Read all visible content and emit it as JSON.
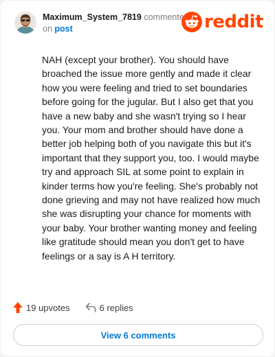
{
  "comment": {
    "username": "Maximum_System_7819",
    "action_text": "commented",
    "on_text": "on",
    "post_link": "post",
    "body": "NAH (except your brother). You should have broached the issue more gently and made it clear how you were feeling and tried to set boundaries before going for the jugular. But I also get that you have a new baby and she wasn't trying so I hear you. Your mom and brother should have done a better job helping both of you navigate this but it's important that they support you, too. I would maybe try and approach SIL at some point to explain in kinder terms how you're feeling. She's probably not done grieving and may not have realized how much she was disrupting your chance for moments with your baby. Your brother wanting money and feeling like gratitude should mean you don't get to have feelings or a say is A H territory.",
    "upvotes": "19 upvotes",
    "replies": "6 replies",
    "view_comments": "View 6 comments"
  },
  "brand": {
    "logo_text": "reddit",
    "icon": "reddit-snoo-icon",
    "accent_color": "#ff4500",
    "link_color": "#0079d3"
  },
  "icons": {
    "avatar": "avatar",
    "upvote": "upvote-arrow-icon",
    "reply": "reply-arrow-icon"
  }
}
